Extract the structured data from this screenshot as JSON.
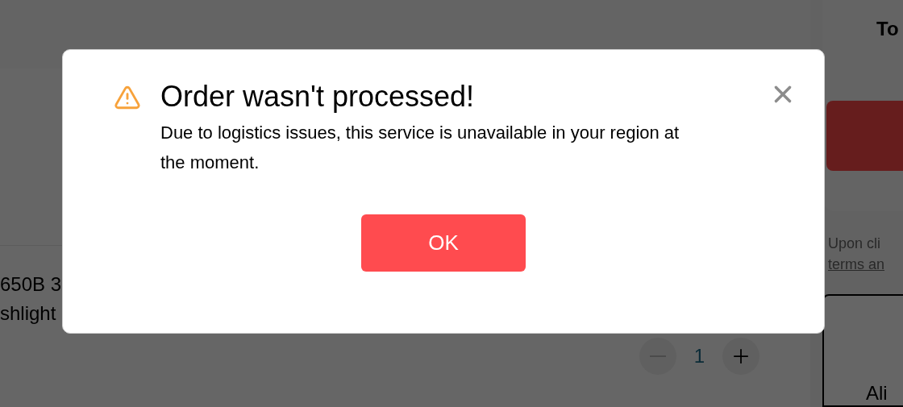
{
  "page": {
    "summary_heading": "To",
    "product_lines": [
      "650B 3",
      "shlight"
    ],
    "quantity": "1",
    "terms_lines": [
      "Upon cli",
      "terms an"
    ],
    "card_heading": "Ali"
  },
  "dialog": {
    "title": "Order wasn't processed!",
    "message": "Due to logistics issues, this service is unavailable in your region at the moment.",
    "button": "OK"
  }
}
